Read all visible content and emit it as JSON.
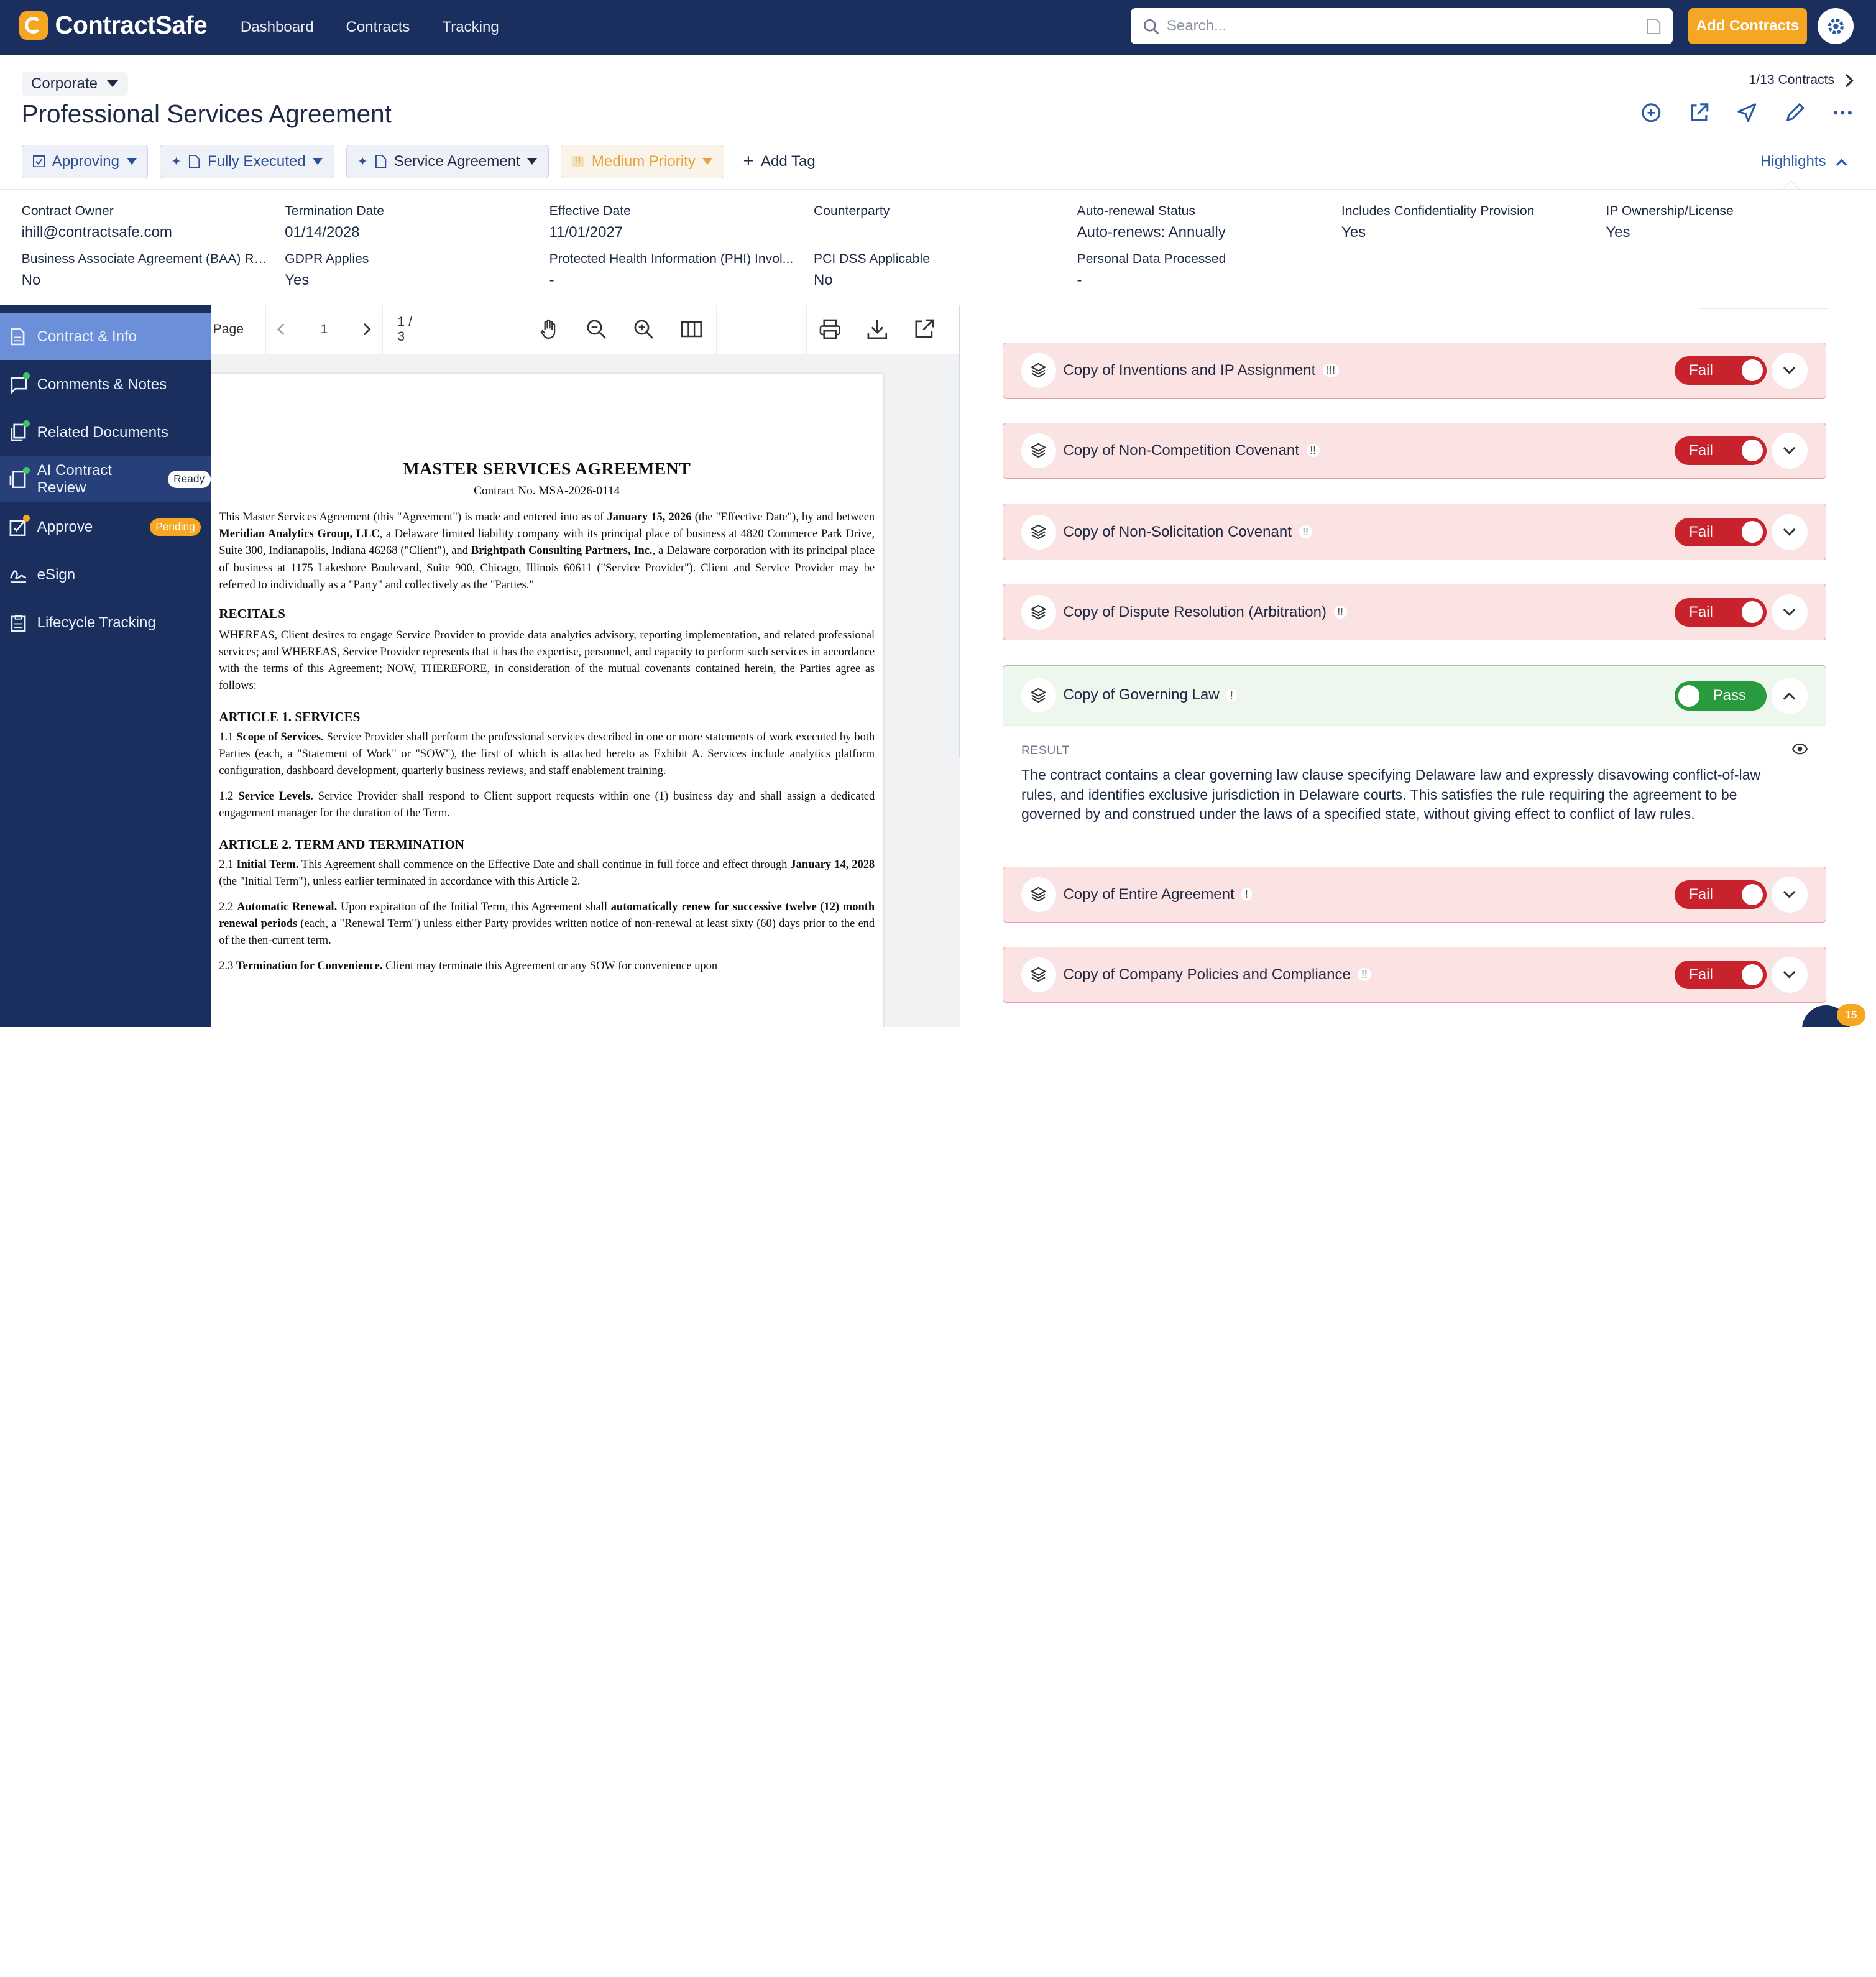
{
  "app": {
    "brand": "ContractSafe"
  },
  "nav": {
    "links": [
      "Dashboard",
      "Contracts",
      "Tracking"
    ],
    "search_placeholder": "Search...",
    "add_button": "Add Contracts"
  },
  "header": {
    "company": "Corporate",
    "title": "Professional Services Agreement",
    "pager": "1/13 Contracts",
    "tags": {
      "status": "Approving",
      "execution": "Fully Executed",
      "type": "Service Agreement",
      "priority": "Medium Priority",
      "add_tag": "Add Tag"
    },
    "highlights": "Highlights"
  },
  "fields": [
    {
      "label": "Contract Owner",
      "value": "ihill@contractsafe.com"
    },
    {
      "label": "Termination Date",
      "value": "01/14/2028"
    },
    {
      "label": "Effective Date",
      "value": "11/01/2027"
    },
    {
      "label": "Counterparty",
      "value": ""
    },
    {
      "label": "Auto-renewal Status",
      "value": "Auto-renews: Annually"
    },
    {
      "label": "Includes Confidentiality Provision",
      "value": "Yes"
    },
    {
      "label": "IP Ownership/License",
      "value": "Yes"
    },
    {
      "label": "Business Associate Agreement (BAA) Req...",
      "value": "No"
    },
    {
      "label": "GDPR Applies",
      "value": "Yes"
    },
    {
      "label": "Protected Health Information (PHI) Invol...",
      "value": "-"
    },
    {
      "label": "PCI DSS Applicable",
      "value": "No"
    },
    {
      "label": "Personal Data Processed",
      "value": "-"
    }
  ],
  "sidebar": {
    "items": [
      {
        "label": "Contract & Info"
      },
      {
        "label": "Comments & Notes"
      },
      {
        "label": "Related Documents"
      },
      {
        "label": "AI Contract Review",
        "badge": "Ready"
      },
      {
        "label": "Approve",
        "badge": "Pending"
      },
      {
        "label": "eSign"
      },
      {
        "label": "Lifecycle Tracking"
      }
    ]
  },
  "pdf": {
    "page_label": "Page",
    "page_value": "1",
    "page_count": "1 / 3",
    "title": "MASTER SERVICES AGREEMENT",
    "contract_no": "Contract No. MSA-2026-0114",
    "intro": {
      "a": "This Master Services Agreement (this \"Agreement\") is made and entered into as of ",
      "date": "January 15, 2026",
      "b": " (the \"Effective Date\"), by and between ",
      "party1": "Meridian Analytics Group, LLC",
      "c": ", a Delaware limited liability company with its principal place of business at 4820 Commerce Park Drive, Suite 300, Indianapolis, Indiana 46268 (\"Client\"), and ",
      "party2": "Brightpath Consulting Partners, Inc.",
      "d": ", a Delaware corporation with its principal place of business at 1175 Lakeshore Boulevard, Suite 900, Chicago, Illinois 60611 (\"Service Provider\"). Client and Service Provider may be referred to individually as a \"Party\" and collectively as the \"Parties.\""
    },
    "recitals_heading": "RECITALS",
    "recitals": "WHEREAS, Client desires to engage Service Provider to provide data analytics advisory, reporting implementation, and related professional services; and WHEREAS, Service Provider represents that it has the expertise, personnel, and capacity to perform such services in accordance with the terms of this Agreement; NOW, THEREFORE, in consideration of the mutual covenants contained herein, the Parties agree as follows:",
    "art1_heading": "ARTICLE 1. SERVICES",
    "s11_num": "1.1 ",
    "s11_title": "Scope of Services.",
    "s11": " Service Provider shall perform the professional services described in one or more statements of work executed by both Parties (each, a \"Statement of Work\" or \"SOW\"), the first of which is attached hereto as Exhibit A. Services include analytics platform configuration, dashboard development, quarterly business reviews, and staff enablement training.",
    "s12_num": "1.2 ",
    "s12_title": "Service Levels.",
    "s12": " Service Provider shall respond to Client support requests within one (1) business day and shall assign a dedicated engagement manager for the duration of the Term.",
    "art2_heading": "ARTICLE 2. TERM AND TERMINATION",
    "s21_num": "2.1 ",
    "s21_title": "Initial Term.",
    "s21_a": " This Agreement shall commence on the Effective Date and shall continue in full force and effect through ",
    "s21_date": "January 14, 2028",
    "s21_b": " (the \"Initial Term\"), unless earlier terminated in accordance with this Article 2.",
    "s22_num": "2.2 ",
    "s22_title": "Automatic Renewal.",
    "s22_a": " Upon expiration of the Initial Term, this Agreement shall ",
    "s22_bold": "automatically renew for successive twelve (12) month renewal periods",
    "s22_b": " (each, a \"Renewal Term\") unless either Party provides written notice of non-renewal at least sixty (60) days prior to the end of the then-current term.",
    "s23_num": "2.3 ",
    "s23_title": "Termination for Convenience.",
    "s23": " Client may terminate this Agreement or any SOW for convenience upon"
  },
  "review": {
    "items": [
      {
        "title": "Copy of Inventions and IP Assignment",
        "flag": "!!!",
        "status": "Fail"
      },
      {
        "title": "Copy of Non-Competition Covenant",
        "flag": "!!",
        "status": "Fail"
      },
      {
        "title": "Copy of Non-Solicitation Covenant",
        "flag": "!!",
        "status": "Fail"
      },
      {
        "title": "Copy of Dispute Resolution (Arbitration)",
        "flag": "!!",
        "status": "Fail"
      },
      {
        "title": "Copy of Governing Law",
        "flag": "!",
        "status": "Pass"
      },
      {
        "title": "Copy of Entire Agreement",
        "flag": "!",
        "status": "Fail"
      },
      {
        "title": "Copy of Company Policies and Compliance",
        "flag": "!!",
        "status": "Fail"
      }
    ],
    "result_label": "RESULT",
    "result_text": "The contract contains a clear governing law clause specifying Delaware law and expressly disavowing conflict-of-law rules, and identifies exclusive jurisdiction in Delaware courts. This satisfies the rule requiring the agreement to be governed by and construed under the laws of a specified state, without giving effect to conflict of law rules."
  },
  "chat": {
    "count": "15"
  },
  "colors": {
    "nav": "#1b2f5e",
    "accent": "#f5a623",
    "fail": "#c8232c",
    "pass": "#2a9a3e"
  }
}
